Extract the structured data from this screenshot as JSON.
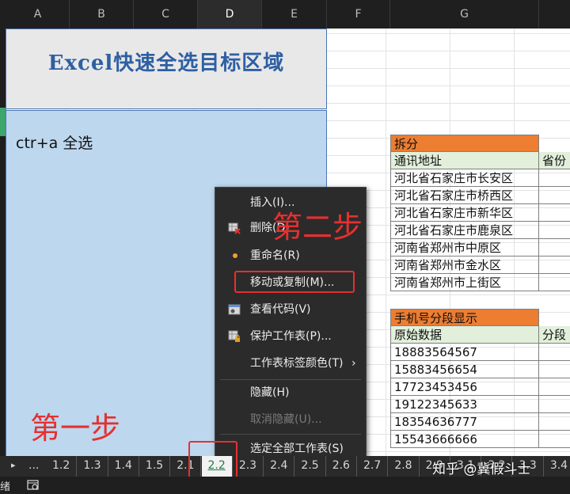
{
  "columns": [
    "A",
    "B",
    "C",
    "D",
    "E",
    "F",
    "G"
  ],
  "active_column": "D",
  "title_box": {
    "text": "Excel快速全选目标区域"
  },
  "content_box": {
    "text": "ctr+a 全选"
  },
  "split_table": {
    "header": "拆分",
    "col1_header": "通讯地址",
    "col2_header": "省份",
    "rows": [
      "河北省石家庄市长安区",
      "河北省石家庄市桥西区",
      "河北省石家庄市新华区",
      "河北省石家庄市鹿泉区",
      "河南省郑州市中原区",
      "河南省郑州市金水区",
      "河南省郑州市上街区"
    ]
  },
  "phone_table": {
    "header": "手机号分段显示",
    "col1_header": "原始数据",
    "col2_header": "分段",
    "rows": [
      "18883564567",
      "15883456654",
      "17723453456",
      "19122345633",
      "18354636777",
      "15543666666"
    ]
  },
  "context_menu": {
    "items": [
      {
        "label": "插入(I)...",
        "icon": "none",
        "disabled": false
      },
      {
        "label": "删除(D)",
        "icon": "delete-sheet-icon",
        "disabled": false
      },
      {
        "label": "重命名(R)",
        "icon": "dot-icon",
        "disabled": false
      },
      {
        "label": "移动或复制(M)...",
        "icon": "none",
        "disabled": false
      },
      {
        "label": "查看代码(V)",
        "icon": "view-code-icon",
        "disabled": false
      },
      {
        "label": "保护工作表(P)...",
        "icon": "protect-sheet-icon",
        "disabled": false
      },
      {
        "label": "工作表标签颜色(T)",
        "icon": "none",
        "disabled": false,
        "submenu": true
      },
      {
        "label": "隐藏(H)",
        "icon": "none",
        "disabled": false
      },
      {
        "label": "取消隐藏(U)...",
        "icon": "none",
        "disabled": true
      },
      {
        "label": "选定全部工作表(S)",
        "icon": "none",
        "disabled": false
      }
    ],
    "submenu_arrow": "›"
  },
  "annotations": {
    "step1": "第一步",
    "step2": "第二步"
  },
  "sheet_tabs": {
    "nav": "▸",
    "ellipsis": "...",
    "tabs": [
      "1.2",
      "1.3",
      "1.4",
      "1.5",
      "2.1",
      "2.2",
      "2.3",
      "2.4",
      "2.5",
      "2.6",
      "2.7",
      "2.8",
      "2.9",
      "3.1",
      "3.2",
      "3.3",
      "3.4"
    ],
    "active": "2.2"
  },
  "status_bar": {
    "text": "绪"
  },
  "watermark": "知乎 @冀假斗士",
  "colors": {
    "accent_red": "#e53030",
    "header_orange": "#ed7d31",
    "header_green": "#e2efda",
    "content_blue": "#bdd7ee",
    "title_blue": "#2e5fa3"
  }
}
